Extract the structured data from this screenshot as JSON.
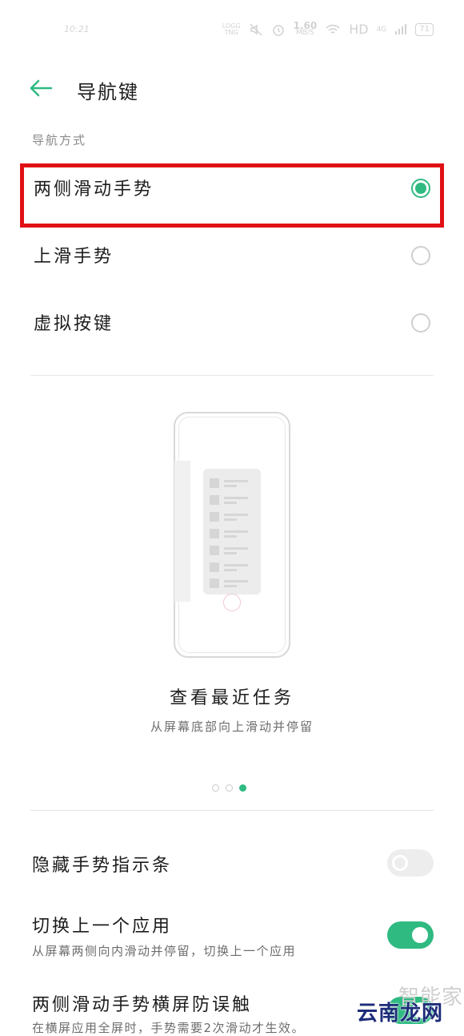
{
  "status_bar": {
    "time": "10:21",
    "lg_label": "LOGG\nTNG",
    "speed_value": "1.60",
    "speed_unit": "MB/S",
    "hd": "HD",
    "network": "4G",
    "battery": "71"
  },
  "header": {
    "title": "导航键",
    "back_icon": "arrow-left-icon"
  },
  "navigation": {
    "section_label": "导航方式",
    "options": [
      {
        "label": "两侧滑动手势",
        "selected": true
      },
      {
        "label": "上滑手势",
        "selected": false
      },
      {
        "label": "虚拟按键",
        "selected": false
      }
    ]
  },
  "preview": {
    "title": "查看最近任务",
    "description": "从屏幕底部向上滑动并停留",
    "page_count": 3,
    "active_page": 3
  },
  "settings": [
    {
      "label": "隐藏手势指示条",
      "description": "",
      "enabled": false
    },
    {
      "label": "切换上一个应用",
      "description": "从屏幕两侧向内滑动并停留，切换上一个应用",
      "enabled": true
    },
    {
      "label": "两侧滑动手势横屏防误触",
      "description": "在横屏应用全屏时，手势需要2次滑动才生效。",
      "enabled": true
    }
  ],
  "watermark": {
    "top": "智能家",
    "bottom": "云南龙网"
  },
  "colors": {
    "accent": "#2fba82",
    "highlight_box": "#e01015"
  }
}
